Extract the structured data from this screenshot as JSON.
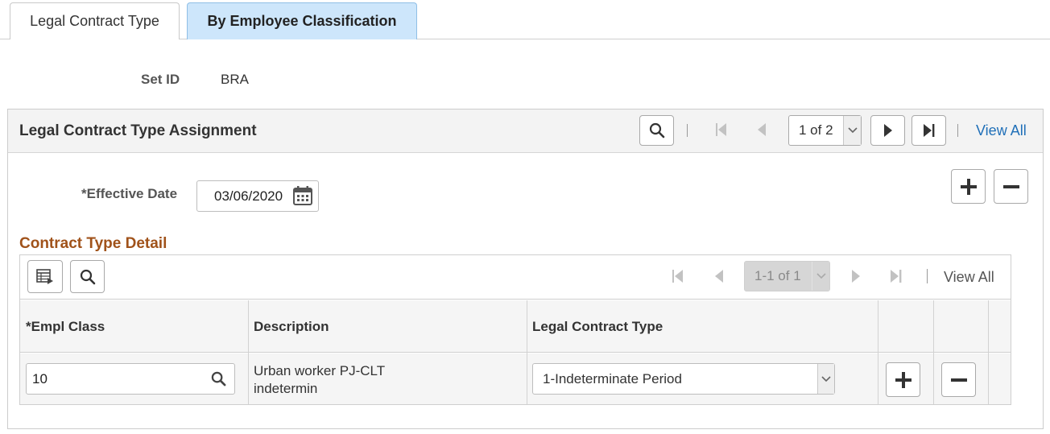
{
  "tabs": [
    {
      "label": "Legal Contract Type",
      "active": false
    },
    {
      "label": "By Employee Classification",
      "active": true
    }
  ],
  "setid": {
    "label": "Set ID",
    "value": "BRA"
  },
  "assignment": {
    "title": "Legal Contract Type Assignment",
    "pager": {
      "value": "1 of 2",
      "view_all": "View All"
    },
    "effective_date": {
      "label": "*Effective Date",
      "value": "03/06/2020"
    }
  },
  "detail": {
    "title": "Contract Type Detail",
    "pager": {
      "value": "1-1 of 1",
      "view_all": "View All"
    },
    "columns": [
      "*Empl Class",
      "Description",
      "Legal Contract Type"
    ],
    "rows": [
      {
        "empl_class": "10",
        "description_1": "Urban worker PJ-CLT",
        "description_2": "indetermin",
        "legal_contract_type": "1-Indeterminate Period"
      }
    ]
  },
  "colors": {
    "accent_link": "#1f6fb8",
    "active_tab": "#cde6fb",
    "section_title": "#a0521a"
  }
}
